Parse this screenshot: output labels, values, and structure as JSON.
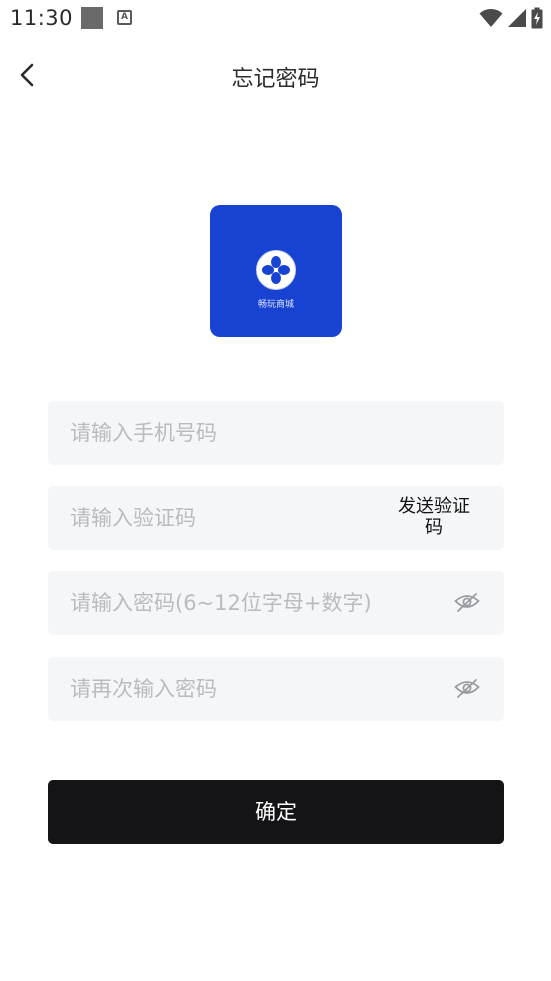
{
  "status_bar": {
    "time": "11:30",
    "notif_a_glyph": "A",
    "icons": [
      "notification-square-icon",
      "accessibility-a-icon",
      "wifi-icon",
      "signal-icon",
      "battery-charging-icon"
    ]
  },
  "header": {
    "title": "忘记密码",
    "back_icon": "chevron-left-icon"
  },
  "logo": {
    "text": "畅玩商城",
    "background": "#1842d2"
  },
  "form": {
    "phone": {
      "placeholder": "请输入手机号码",
      "value": ""
    },
    "code": {
      "placeholder": "请输入验证码",
      "value": "",
      "send_label_line1": "发送验证",
      "send_label_line2": "码"
    },
    "password": {
      "placeholder": "请输入密码(6~12位字母+数字)",
      "value": "",
      "eye_icon": "eye-off-icon"
    },
    "password_confirm": {
      "placeholder": "请再次输入密码",
      "value": "",
      "eye_icon": "eye-off-icon"
    }
  },
  "confirm": {
    "label": "确定",
    "background": "#141416"
  },
  "colors": {
    "field_bg": "#f5f6f8",
    "placeholder": "#b9bbc0"
  }
}
